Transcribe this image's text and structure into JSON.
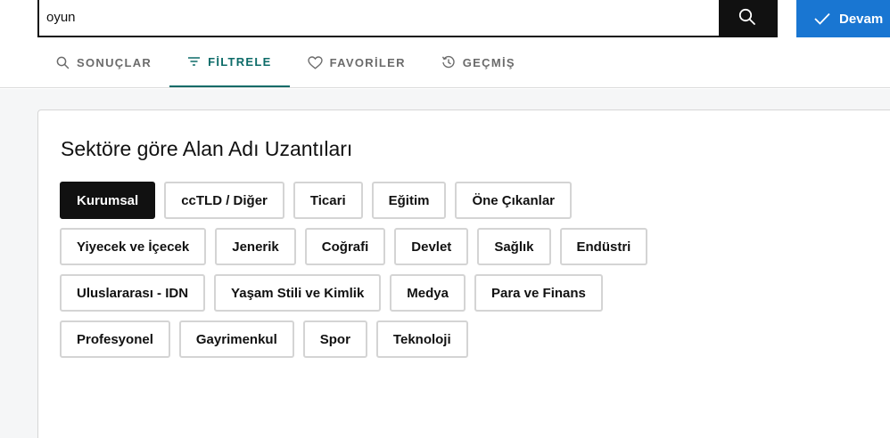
{
  "search": {
    "value": "oyun"
  },
  "continue_label": "Devam",
  "tabs": [
    {
      "label": "SONUÇLAR",
      "icon": "search-icon"
    },
    {
      "label": "FİLTRELE",
      "icon": "filter-icon",
      "active": true
    },
    {
      "label": "FAVORİLER",
      "icon": "heart-icon"
    },
    {
      "label": "GEÇMİŞ",
      "icon": "history-icon"
    }
  ],
  "panel": {
    "title": "Sektöre göre Alan Adı Uzantıları",
    "rows": [
      [
        "Kurumsal",
        "ccTLD / Diğer",
        "Ticari",
        "Eğitim",
        "Öne Çıkanlar"
      ],
      [
        "Yiyecek ve İçecek",
        "Jenerik",
        "Coğrafi",
        "Devlet",
        "Sağlık",
        "Endüstri"
      ],
      [
        "Uluslararası - IDN",
        "Yaşam Stili ve Kimlik",
        "Medya",
        "Para ve Finans"
      ],
      [
        "Profesyonel",
        "Gayrimenkul",
        "Spor",
        "Teknoloji"
      ]
    ],
    "selected": "Kurumsal"
  },
  "colors": {
    "accent": "#0c6b68",
    "primary_button": "#1976d2",
    "dark": "#111111"
  }
}
